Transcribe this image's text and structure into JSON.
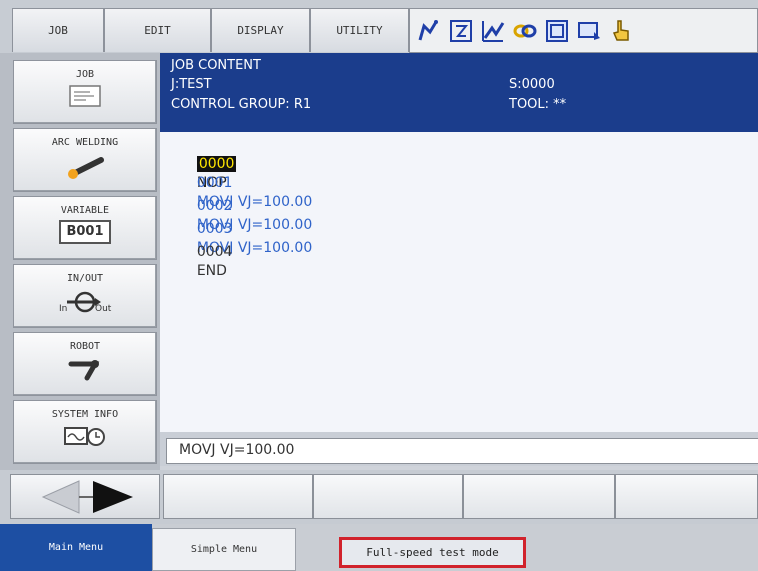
{
  "menu": {
    "tabs": [
      "JOB",
      "EDIT",
      "DISPLAY",
      "UTILITY"
    ]
  },
  "toolbar_icons": [
    "robot-arm-icon",
    "edit-box-icon",
    "chart-icon",
    "link-icon",
    "panel-icon",
    "display-icon",
    "hand-pointer-icon"
  ],
  "side_menu": [
    {
      "label": "JOB",
      "icon": "job-document-icon"
    },
    {
      "label": "ARC WELDING",
      "icon": "welding-torch-icon"
    },
    {
      "label": "VARIABLE",
      "icon": "variable-box-icon",
      "badge": "B001"
    },
    {
      "label": "IN/OUT",
      "icon": "in-out-icon",
      "sub_in": "In",
      "sub_out": "Out"
    },
    {
      "label": "ROBOT",
      "icon": "robot-icon"
    },
    {
      "label": "SYSTEM INFO",
      "icon": "system-info-icon"
    }
  ],
  "job": {
    "header_title": "JOB CONTENT",
    "job_name": "J:TEST",
    "control_group": "CONTROL GROUP: R1",
    "step": "S:0000",
    "tool": "TOOL: **",
    "lines": [
      {
        "num": "0000",
        "text": "NOP",
        "highlight": true
      },
      {
        "num": "0001",
        "text": "MOVJ VJ=100.00",
        "highlight": false
      },
      {
        "num": "0002",
        "text": "MOVJ VJ=100.00",
        "highlight": false
      },
      {
        "num": "0003",
        "text": "MOVJ VJ=100.00",
        "highlight": false
      },
      {
        "num": "0004",
        "text": "END",
        "highlight": false
      }
    ],
    "edit_line": "MOVJ VJ=100.00"
  },
  "status": {
    "main_menu": "Main Menu",
    "simple_menu": "Simple Menu",
    "mode": "Full-speed test mode"
  },
  "colors": {
    "header_bg": "#1b3d8c",
    "instruction_blue": "#2f63c9",
    "mode_border": "#d1222b",
    "main_menu_bg": "#1d4fa3"
  }
}
